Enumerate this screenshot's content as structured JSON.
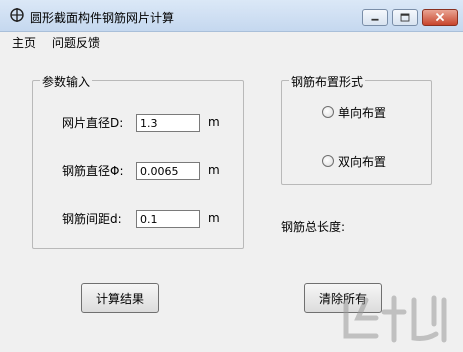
{
  "window": {
    "title": "圆形截面构件钢筋网片计算",
    "icon": "rebar-app-icon"
  },
  "menu": {
    "items": [
      "主页",
      "问题反馈"
    ]
  },
  "params": {
    "group_title": "参数输入",
    "mesh_diameter": {
      "label": "网片直径D:",
      "value": "1.3",
      "unit": "m"
    },
    "bar_diameter": {
      "label": "钢筋直径Φ:",
      "value": "0.0065",
      "unit": "m"
    },
    "bar_spacing": {
      "label": "钢筋间距d:",
      "value": "0.1",
      "unit": "m"
    }
  },
  "layout_options": {
    "group_title": "钢筋布置形式",
    "options": [
      "单向布置",
      "双向布置"
    ]
  },
  "total_length_label": "钢筋总长度:",
  "buttons": {
    "calculate": "计算结果",
    "clear": "清除所有"
  },
  "colors": {
    "titlebar": "#c5d8ef",
    "close_button": "#c8452c",
    "background": "#f0f0f0"
  }
}
